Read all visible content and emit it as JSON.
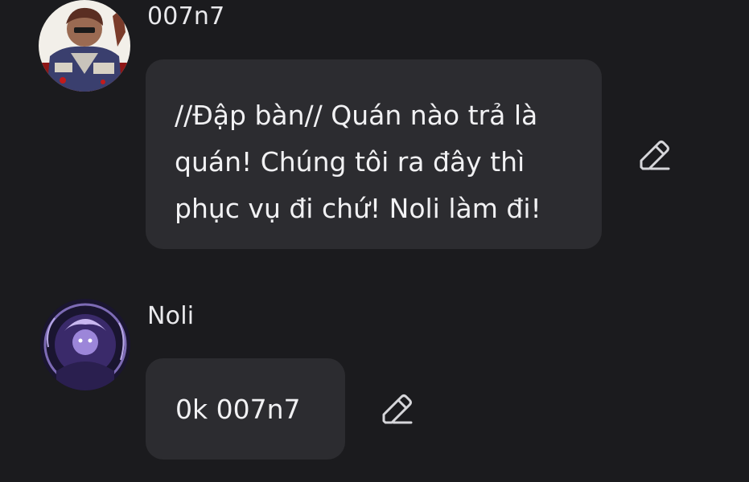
{
  "messages": [
    {
      "username": "007n7",
      "avatar_icon": "character-avatar-icon",
      "text": "//Đập bàn// Quán nào trả là\nquán! Chúng tôi ra đây thì\nphục vụ đi chứ! Noli làm đi!",
      "edit_icon": "pencil-edit-icon"
    },
    {
      "username": "Noli",
      "avatar_icon": "character-avatar-icon",
      "text": "0k 007n7",
      "edit_icon": "pencil-edit-icon"
    }
  ],
  "colors": {
    "background": "#1b1b1e",
    "bubble": "#2c2c30",
    "text": "#f1f1f3",
    "icon": "#d6d6da"
  }
}
